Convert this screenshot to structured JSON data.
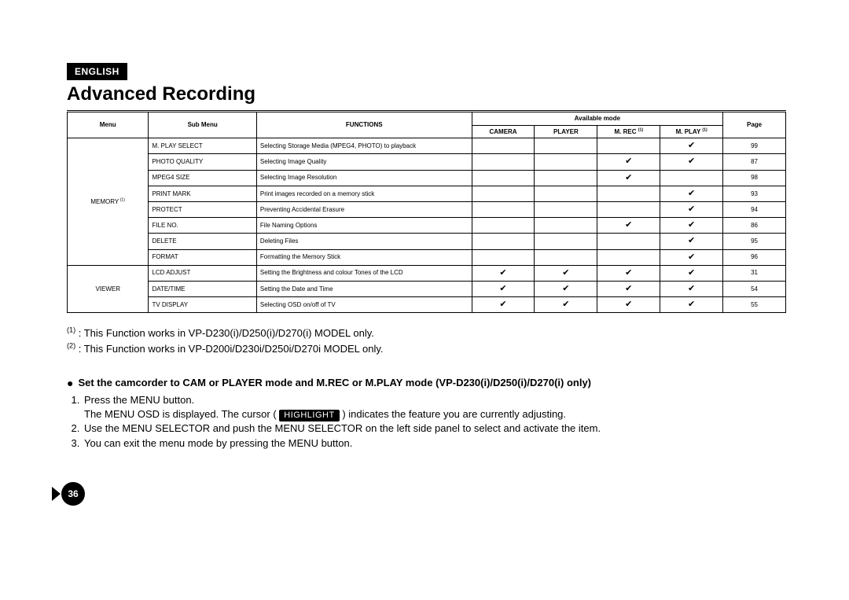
{
  "lang_badge": "ENGLISH",
  "title": "Advanced Recording",
  "table": {
    "hdr_available_mode": "Available mode",
    "hdr_menu": "Menu",
    "hdr_submenu": "Sub Menu",
    "hdr_functions": "FUNCTIONS",
    "hdr_camera": "CAMERA",
    "hdr_player": "PLAYER",
    "hdr_mrec": "M. REC",
    "hdr_mplay": "M. PLAY",
    "hdr_page": "Page",
    "sup1": "(1)",
    "groups": [
      {
        "menu": "MEMORY",
        "menu_sup": "(1)",
        "rows": [
          {
            "sub": "M. PLAY SELECT",
            "func": "Selecting Storage Media (MPEG4, PHOTO) to playback",
            "camera": false,
            "player": false,
            "mrec": false,
            "mplay": true,
            "page": "99"
          },
          {
            "sub": "PHOTO QUALITY",
            "func": "Selecting Image Quality",
            "camera": false,
            "player": false,
            "mrec": true,
            "mplay": true,
            "page": "87"
          },
          {
            "sub": "MPEG4 SIZE",
            "func": "Selecting Image Resolution",
            "camera": false,
            "player": false,
            "mrec": true,
            "mplay": false,
            "page": "98"
          },
          {
            "sub": "PRINT MARK",
            "func": "Print images recorded on a memory stick",
            "camera": false,
            "player": false,
            "mrec": false,
            "mplay": true,
            "page": "93"
          },
          {
            "sub": "PROTECT",
            "func": "Preventing Accidental Erasure",
            "camera": false,
            "player": false,
            "mrec": false,
            "mplay": true,
            "page": "94"
          },
          {
            "sub": "FILE NO.",
            "func": "File Naming Options",
            "camera": false,
            "player": false,
            "mrec": true,
            "mplay": true,
            "page": "86"
          },
          {
            "sub": "DELETE",
            "func": "Deleting Files",
            "camera": false,
            "player": false,
            "mrec": false,
            "mplay": true,
            "page": "95"
          },
          {
            "sub": "FORMAT",
            "func": "Formatting the Memory Stick",
            "camera": false,
            "player": false,
            "mrec": false,
            "mplay": true,
            "page": "96"
          }
        ]
      },
      {
        "menu": "VIEWER",
        "menu_sup": "",
        "rows": [
          {
            "sub": "LCD ADJUST",
            "func": "Setting the Brightness and colour Tones of the LCD",
            "camera": true,
            "player": true,
            "mrec": true,
            "mplay": true,
            "page": "31"
          },
          {
            "sub": "DATE/TIME",
            "func": "Setting the Date and Time",
            "camera": true,
            "player": true,
            "mrec": true,
            "mplay": true,
            "page": "54"
          },
          {
            "sub": "TV DISPLAY",
            "func": "Selecting OSD on/off of TV",
            "camera": true,
            "player": true,
            "mrec": true,
            "mplay": true,
            "page": "55"
          }
        ]
      }
    ]
  },
  "notes": {
    "n1_sup": "(1)",
    "n1_text": " : This Function works in VP-D230(i)/D250(i)/D270(i) MODEL only.",
    "n2_sup": "(2)",
    "n2_text": " : This Function works in VP-D200i/D230i/D250i/D270i MODEL only."
  },
  "bold_line": "Set the camcorder to CAM or PLAYER mode and M.REC or M.PLAY mode (VP-D230(i)/D250(i)/D270(i) only)",
  "instructions": {
    "i1": "Press the MENU button.",
    "i1b_pre": "The MENU OSD is displayed. The cursor ( ",
    "highlight_label": "HIGHLIGHT",
    "i1b_post": " ) indicates the feature you are currently adjusting.",
    "i2": "Use the MENU SELECTOR and push the MENU SELECTOR on the left side panel to select and activate the item.",
    "i3": "You can exit the menu mode by pressing the MENU button."
  },
  "page_number": "36"
}
